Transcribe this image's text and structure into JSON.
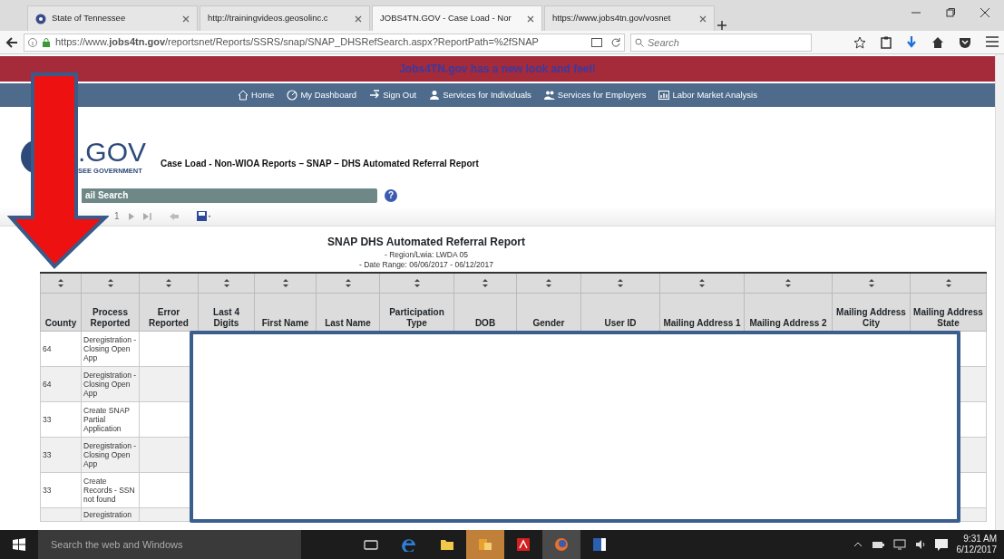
{
  "browser": {
    "tabs": [
      {
        "title": "State of Tennessee",
        "selected": false
      },
      {
        "title": "http://trainingvideos.geosolinc.c",
        "selected": false
      },
      {
        "title": "JOBS4TN.GOV - Case Load - Nor",
        "selected": true
      },
      {
        "title": "https://www.jobs4tn.gov/vosnet",
        "selected": false
      }
    ],
    "url": "https://www.**jobs4tn.gov**/reportsnet/Reports/SSRS/snap/SNAP_DHSRefSearch.aspx?ReportPath=%2fSNAP",
    "search": {
      "placeholder": "Search"
    }
  },
  "banner": "Jobs4TN.gov has a new look and feel!",
  "nav": [
    {
      "kind": "home",
      "label": "Home"
    },
    {
      "kind": "dashboard",
      "label": "My Dashboard"
    },
    {
      "kind": "signout",
      "label": "Sign Out"
    },
    {
      "kind": "person",
      "label": "Services for Individuals"
    },
    {
      "kind": "people",
      "label": "Services for Employers"
    },
    {
      "kind": "chart",
      "label": "Labor Market Analysis"
    }
  ],
  "logo": {
    "text": ".GOV",
    "subtext": "SEE GOVERNMENT"
  },
  "page_title": "Case Load - Non-WIOA Reports – SNAP – DHS Automated Referral Report",
  "search_panel": {
    "title": "ail Search",
    "help": "?"
  },
  "toolbar": {
    "page": "1"
  },
  "report": {
    "title": "SNAP DHS Automated Referral Report",
    "lines": [
      "- Region/Lwia: LWDA 05",
      "- Date Range: 06/06/2017 - 06/12/2017"
    ]
  },
  "table": {
    "columns": [
      "County",
      "Process Reported",
      "Error Reported",
      "Last 4 Digits",
      "First Name",
      "Last Name",
      "Participation Type",
      "DOB",
      "Gender",
      "User ID",
      "Mailing Address 1",
      "Mailing Address 2",
      "Mailing Address City",
      "Mailing Address State"
    ],
    "rows": [
      {
        "cells": [
          "64",
          "Deregistration - Closing Open App"
        ]
      },
      {
        "cells": [
          "64",
          "Deregistration - Closing Open App"
        ]
      },
      {
        "cells": [
          "33",
          "Create SNAP Partial Application"
        ]
      },
      {
        "cells": [
          "33",
          "Deregistration - Closing Open App"
        ]
      },
      {
        "cells": [
          "33",
          "Create Records - SSN not found"
        ]
      },
      {
        "cells": [
          "",
          "Deregistration"
        ]
      }
    ]
  },
  "annotations": {
    "arrow": true,
    "redaction": true
  },
  "taskbar": {
    "search_placeholder": "Search the web and Windows",
    "apps": [
      {
        "kind": "taskview",
        "active": false
      },
      {
        "kind": "edge",
        "active": false
      },
      {
        "kind": "folder",
        "active": false
      },
      {
        "kind": "outlook",
        "active": true
      },
      {
        "kind": "acrobat",
        "active": false
      },
      {
        "kind": "firefox",
        "active": true
      },
      {
        "kind": "word",
        "active": false
      }
    ],
    "time": "9:31 AM",
    "date": "6/12/2017"
  }
}
